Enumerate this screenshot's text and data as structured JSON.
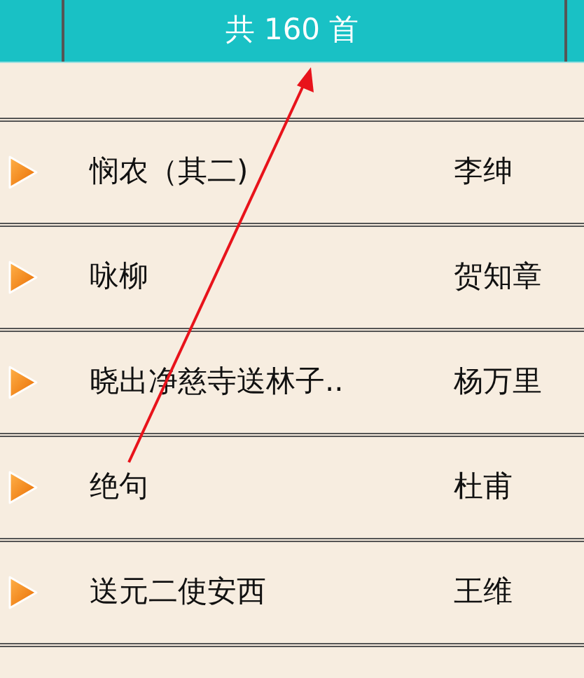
{
  "header": {
    "title": "共 160 首"
  },
  "poems": [
    {
      "title": "悯农（其二)",
      "author": "李绅"
    },
    {
      "title": "咏柳",
      "author": "贺知章"
    },
    {
      "title": "晓出净慈寺送林子..",
      "author": "杨万里"
    },
    {
      "title": "绝句",
      "author": "杜甫"
    },
    {
      "title": "送元二使安西",
      "author": "王维"
    }
  ]
}
